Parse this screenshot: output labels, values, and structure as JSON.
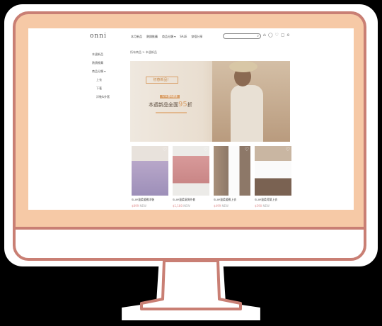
{
  "header": {
    "logo": "onni",
    "nav": [
      "本月新品",
      "熱銷推薦",
      "商品分類 ▾",
      "SALE",
      "穿搭分享"
    ],
    "search_placeholder": ""
  },
  "icons": [
    "search-icon",
    "home-icon",
    "user-icon",
    "heart-icon",
    "bag-icon",
    "person-icon"
  ],
  "sidebar": {
    "items": [
      "本週新品",
      "熱銷推薦",
      "商品分類 ▾",
      "上衣",
      "下著",
      "洋裝&外套"
    ]
  },
  "breadcrumb": "所有商品 > 本週新品",
  "banner": {
    "tag": "初春新品！",
    "chip": "3/31限時優惠",
    "headline": "本週新品全面",
    "discount": "95",
    "discount_unit": "折"
  },
  "products": [
    {
      "title": "SLAY溫柔優雅洋裝",
      "price": "$899",
      "note": "NEW",
      "colors": [
        "#b8a7c9",
        "#9d8fb9",
        "#e8e2dc"
      ]
    },
    {
      "title": "SLAY溫柔氣質外套",
      "price": "$1,180",
      "note": "NEW",
      "colors": [
        "#d89a9a",
        "#c98686",
        "#ecebe8"
      ]
    },
    {
      "title": "SLAY溫柔優雅上衣",
      "price": "$499",
      "note": "NEW",
      "colors": [
        "#fbfbfb",
        "#a8907a",
        "#8d7868"
      ]
    },
    {
      "title": "SLAY溫柔荷葉上衣",
      "price": "$590",
      "note": "NEW",
      "colors": [
        "#fafafa",
        "#c9b6a2",
        "#7a6252"
      ]
    }
  ]
}
